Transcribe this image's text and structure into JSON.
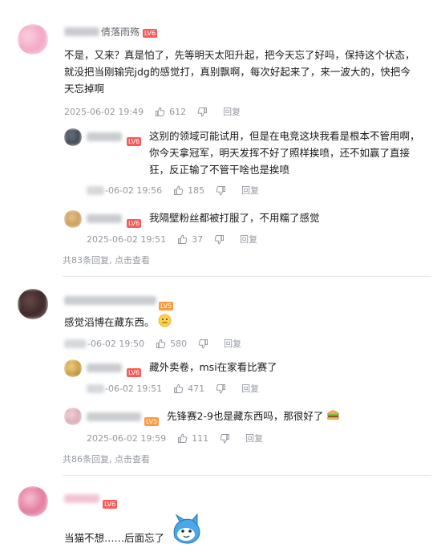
{
  "comments": [
    {
      "username": "倩落雨殇",
      "level": "LV6",
      "text": "不是，又来？真是怕了，先等明天太阳升起，把今天忘了好吗，保持这个状态，就没把当刚输完jdg的感觉打，真别飘啊，每次好起来了，来一波大的，快把今天忘掉啊",
      "time": "2025-06-02 19:49",
      "likes": "612",
      "reply_label": "回复",
      "replies": [
        {
          "level": "LV6",
          "text": "这别的领域可能试用，但是在电竞这块我看是根本不管用啊，你今天拿冠军，明天发挥不好了照样挨喷，还不如赢了直接狂，反正输了不管干啥也是挨喷",
          "time": "-06-02 19:56",
          "likes": "185",
          "reply_label": "回复"
        },
        {
          "level": "LV6",
          "text": "我隔壁粉丝都被打服了，不用糯了感觉",
          "time": "2025-06-02 19:51",
          "likes": "37",
          "reply_label": "回复"
        }
      ],
      "more_replies": "共83条回复, 点击查看"
    },
    {
      "level": "LV5",
      "text": "感觉滔博在藏东西。",
      "time": "-06-02 19:50",
      "likes": "580",
      "reply_label": "回复",
      "replies": [
        {
          "level": "LV6",
          "text": "藏外卖卷，msi在家看比赛了",
          "time": "-06-02 19:51",
          "likes": "471",
          "reply_label": "回复"
        },
        {
          "level": "LV5",
          "text": "先锋赛2-9也是藏东西吗，那很好了",
          "time": "2025-06-02 19:59",
          "likes": "111",
          "reply_label": "回复"
        }
      ],
      "more_replies": "共86条回复, 点击查看"
    },
    {
      "level": "LV6",
      "text": "当猫不想……后面忘了"
    }
  ]
}
